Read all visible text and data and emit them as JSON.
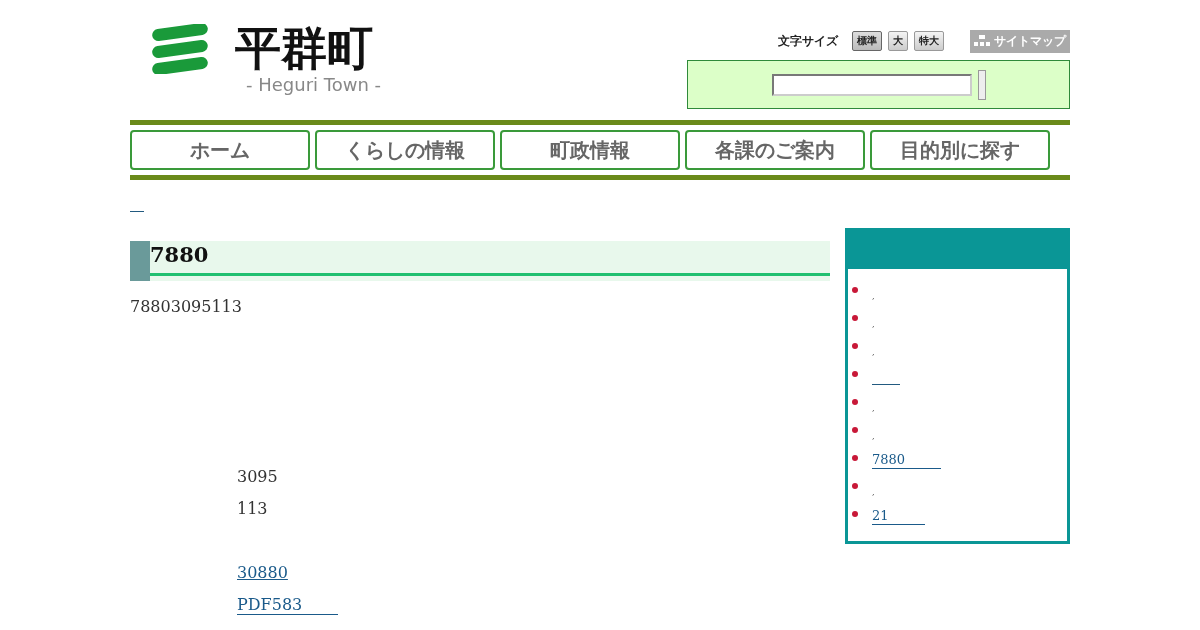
{
  "header": {
    "logo_title": "平群町",
    "logo_subtitle": "- Heguri Town -",
    "font_size_label": "文字サイズ",
    "font_size_buttons": [
      {
        "label": "標準",
        "selected": true
      },
      {
        "label": "大",
        "selected": false
      },
      {
        "label": "特大",
        "selected": false
      }
    ],
    "sitemap": "サイトマップ"
  },
  "nav": [
    {
      "label": "ホーム"
    },
    {
      "label": "くらしの情報"
    },
    {
      "label": "町政情報"
    },
    {
      "label": "各課のご案内"
    },
    {
      "label": "目的別に探す"
    }
  ],
  "breadcrumb": {
    "kind": "blank-link"
  },
  "main": {
    "title": "7880",
    "intro": "78803095113",
    "lines": [
      {
        "kind": "text",
        "text": "3095"
      },
      {
        "kind": "text",
        "text": "113"
      },
      {
        "kind": "gap"
      },
      {
        "kind": "link",
        "text": "30880",
        "trailing": false
      },
      {
        "kind": "link",
        "text": "PDF583",
        "trailing": true
      }
    ]
  },
  "sidebar": {
    "items": [
      {
        "kind": "text",
        "text": ","
      },
      {
        "kind": "text",
        "text": ","
      },
      {
        "kind": "text",
        "text": ","
      },
      {
        "kind": "blank-link"
      },
      {
        "kind": "text",
        "text": ","
      },
      {
        "kind": "text",
        "text": ","
      },
      {
        "kind": "link",
        "text": "7880",
        "trailing": true
      },
      {
        "kind": "text",
        "text": ","
      },
      {
        "kind": "link",
        "text": "21",
        "trailing": true
      }
    ]
  }
}
